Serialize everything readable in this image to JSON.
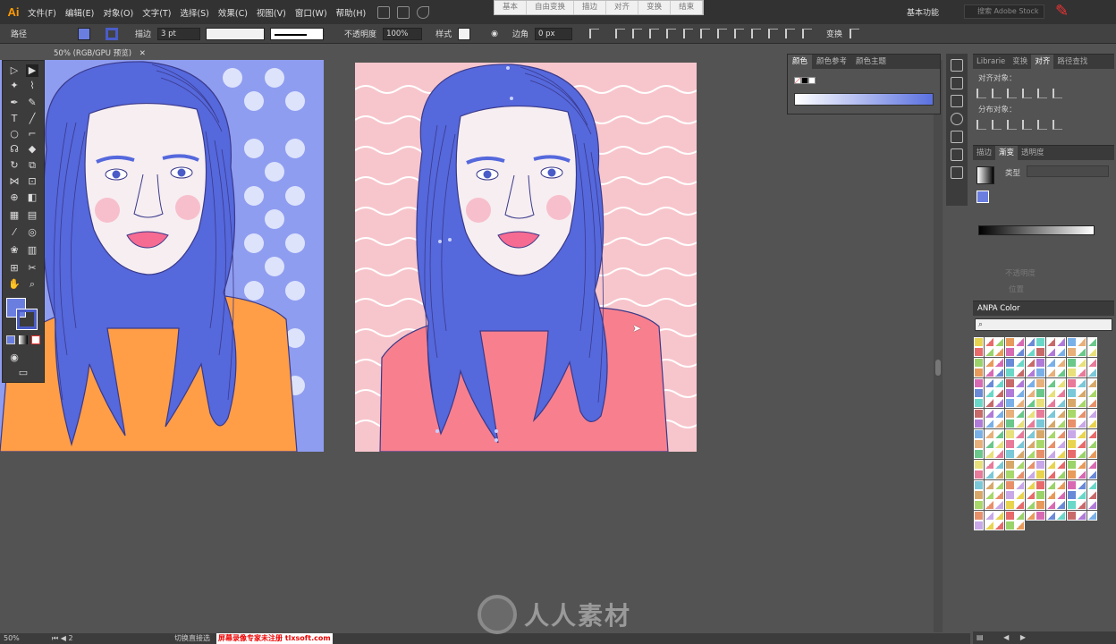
{
  "app": {
    "logo": "Ai"
  },
  "menu": [
    "文件(F)",
    "编辑(E)",
    "对象(O)",
    "文字(T)",
    "选择(S)",
    "效果(C)",
    "视图(V)",
    "窗口(W)",
    "帮助(H)"
  ],
  "top_center": [
    "基本",
    "自由变换",
    "描边",
    "对齐",
    "变换",
    "结束"
  ],
  "workspace": "基本功能",
  "search_placeholder": "搜索 Adobe Stock",
  "control": {
    "path_label": "路径",
    "stroke_label": "描边",
    "stroke_weight": "3 pt",
    "brush_label": "基本",
    "opacity_label": "不透明度",
    "opacity_value": "100%",
    "style_label": "样式",
    "corner_label": "边角",
    "corner_value": "0 px",
    "transform_label": "变换"
  },
  "doc_tab": "50% (RGB/GPU 预览)",
  "color_panel": {
    "tabs": [
      "颜色",
      "颜色参考",
      "颜色主题"
    ]
  },
  "align_panel": {
    "tabs": [
      "Librarie",
      "变换",
      "对齐",
      "路径查找"
    ],
    "align_objects": "对齐对象：",
    "distribute_objects": "分布对象："
  },
  "gradient_panel": {
    "tabs": [
      "描边",
      "渐变",
      "透明度"
    ],
    "type_label": "类型",
    "opacity_label": "不透明度",
    "position_label": "位置"
  },
  "anpa": {
    "title": "ANPA Color"
  },
  "status": {
    "zoom": "50%",
    "page": "2",
    "mode": "切换直接选"
  },
  "watermark": {
    "text": "人人素材",
    "registration": "屏幕录像专家未注册 tlxsoft.com"
  },
  "colors": {
    "hair": "#5568dc",
    "skin": "#f7eef2",
    "shirt_orange": "#ff9e46",
    "shirt_pink": "#f8808e",
    "bg_purple": "#8f9df0",
    "bg_pink": "#f7c6cc",
    "lips": "#f56b92",
    "blush": "#f6b3c2"
  }
}
